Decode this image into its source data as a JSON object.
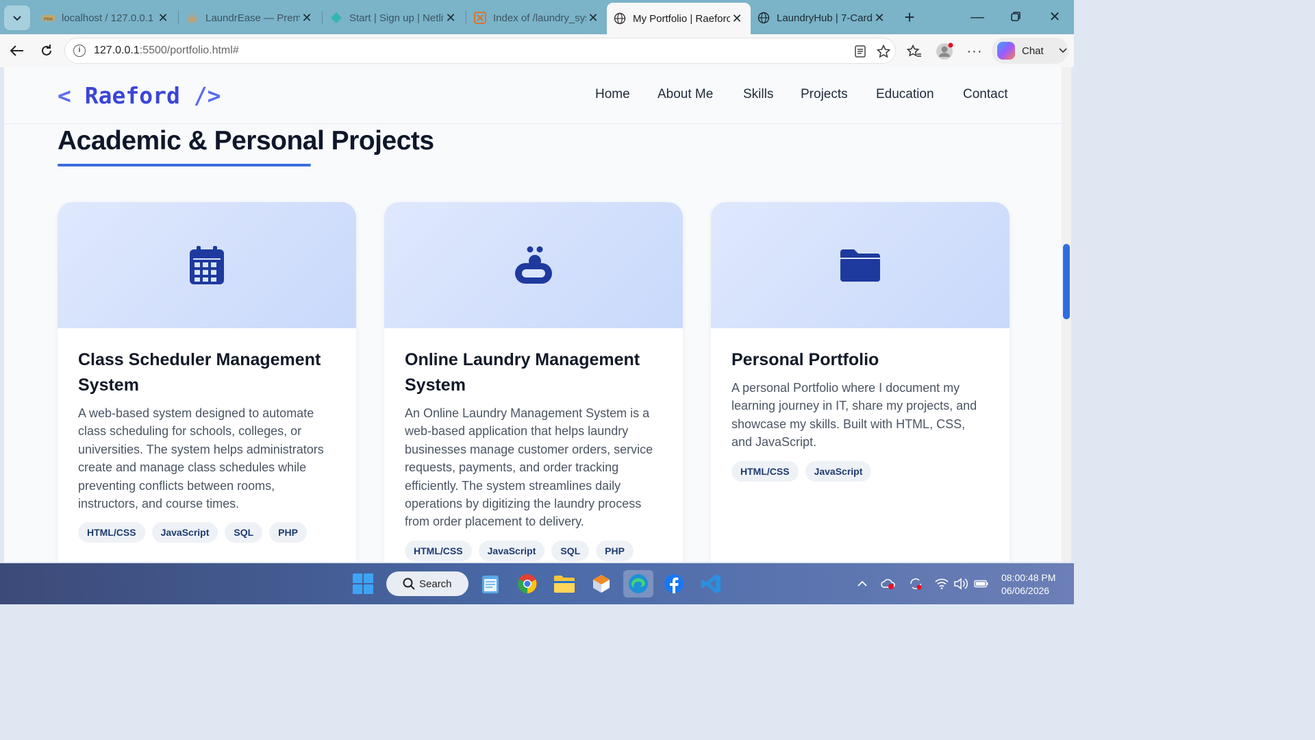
{
  "browser": {
    "tabs": [
      {
        "title": "localhost / 127.0.0.1 /",
        "icon": "phpmyadmin-icon"
      },
      {
        "title": "LaundrEase — Premiu",
        "icon": "laundry-basket-icon"
      },
      {
        "title": "Start | Sign up | Netlif",
        "icon": "netlify-icon"
      },
      {
        "title": "Index of /laundry_sys",
        "icon": "xampp-icon"
      },
      {
        "title": "My Portfolio | Raeforc",
        "icon": "globe-icon"
      },
      {
        "title": "LaundryHub | 7-Card",
        "icon": "globe-icon"
      }
    ],
    "active_tab_index": 4,
    "address": {
      "host": "127.0.0.1",
      "rest": ":5500/portfolio.html#"
    },
    "chat_label": "Chat"
  },
  "site": {
    "logo": {
      "open": "< ",
      "name": "Raeford",
      "close": " />"
    },
    "nav": [
      "Home",
      "About Me",
      "Skills",
      "Projects",
      "Education",
      "Contact"
    ],
    "section_title": "Academic & Personal Projects",
    "projects": [
      {
        "icon": "calendar-icon",
        "title": "Class Scheduler Management System",
        "description": "A web-based system designed to automate class scheduling for schools, colleges, or universities. The system helps administrators create and manage class schedules while preventing conflicts between rooms, instructors, and course times.",
        "tags": [
          "HTML/CSS",
          "JavaScript",
          "SQL",
          "PHP"
        ]
      },
      {
        "icon": "soap-bubbles-icon",
        "title": "Online Laundry Management System",
        "description": "An Online Laundry Management System is a web-based application that helps laundry businesses manage customer orders, service requests, payments, and order tracking efficiently. The system streamlines daily operations by digitizing the laundry process from order placement to delivery.",
        "tags": [
          "HTML/CSS",
          "JavaScript",
          "SQL",
          "PHP"
        ]
      },
      {
        "icon": "folder-icon",
        "title": "Personal Portfolio",
        "description": "A personal Portfolio where I document my learning journey in IT, share my projects, and showcase my skills. Built with HTML, CSS, and JavaScript.",
        "tags": [
          "HTML/CSS",
          "JavaScript"
        ]
      }
    ]
  },
  "taskbar": {
    "search_label": "Search",
    "time": "08:00:48 PM",
    "date": "06/06/2026"
  },
  "colors": {
    "accent": "#3b6fe0",
    "icon_blue": "#1e3a9e",
    "logo": "#3b46d6"
  }
}
